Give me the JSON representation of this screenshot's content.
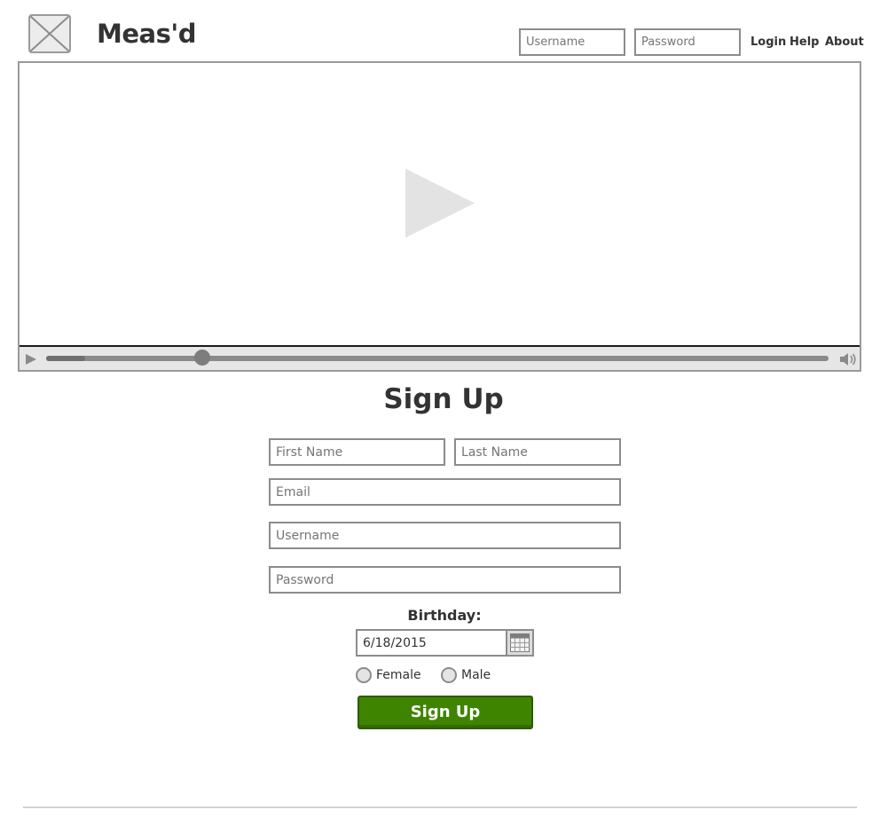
{
  "header": {
    "brand": "Meas'd",
    "username_placeholder": "Username",
    "password_placeholder": "Password",
    "links": {
      "login": "Login",
      "help": "Help",
      "about": "About"
    }
  },
  "video": {
    "progress": 0.2
  },
  "signup": {
    "title": "Sign Up",
    "first_name_placeholder": "First Name",
    "last_name_placeholder": "Last Name",
    "email_placeholder": "Email",
    "username_placeholder": "Username",
    "password_placeholder": "Password",
    "birthday_label": "Birthday:",
    "birthday_value": "6/18/2015",
    "gender_options": [
      "Female",
      "Male"
    ],
    "submit_label": "Sign Up"
  },
  "colors": {
    "submit_green": "#3f8400",
    "border_gray": "#8c8c8c"
  }
}
